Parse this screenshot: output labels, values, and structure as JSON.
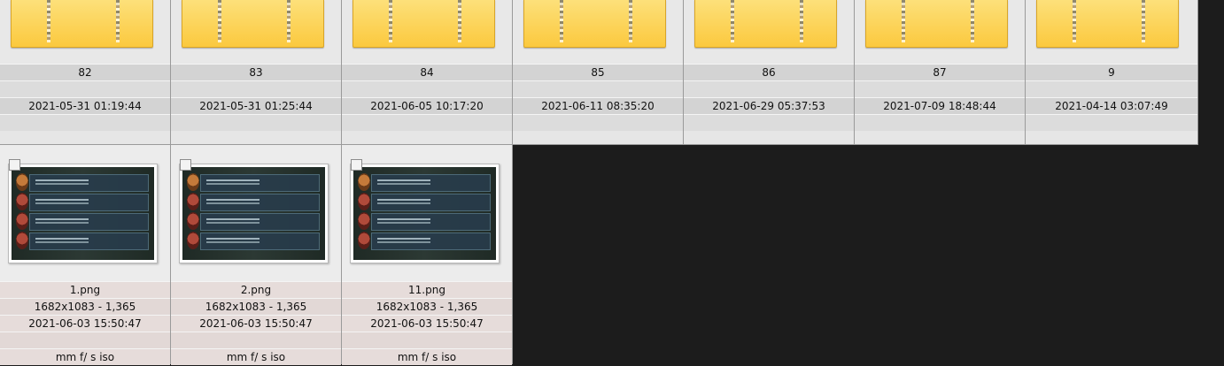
{
  "colors": {
    "background": "#1c1c1c",
    "folder": "#fbc93e",
    "folder_band": "#d3d3d3",
    "image_band": "#e6dcda"
  },
  "folders": [
    {
      "name": "82",
      "date": "2021-05-31 01:19:44"
    },
    {
      "name": "83",
      "date": "2021-05-31 01:25:44"
    },
    {
      "name": "84",
      "date": "2021-06-05 10:17:20"
    },
    {
      "name": "85",
      "date": "2021-06-11 08:35:20"
    },
    {
      "name": "86",
      "date": "2021-06-29 05:37:53"
    },
    {
      "name": "87",
      "date": "2021-07-09 18:48:44"
    },
    {
      "name": "9",
      "date": "2021-04-14 03:07:49"
    }
  ],
  "images": [
    {
      "name": "1.png",
      "dims": "1682x1083 - 1,365",
      "date": "2021-06-03 15:50:47",
      "exif": "mm f/ s iso"
    },
    {
      "name": "2.png",
      "dims": "1682x1083 - 1,365",
      "date": "2021-06-03 15:50:47",
      "exif": "mm f/ s iso"
    },
    {
      "name": "11.png",
      "dims": "1682x1083 - 1,365",
      "date": "2021-06-03 15:50:47",
      "exif": "mm f/ s iso"
    }
  ]
}
